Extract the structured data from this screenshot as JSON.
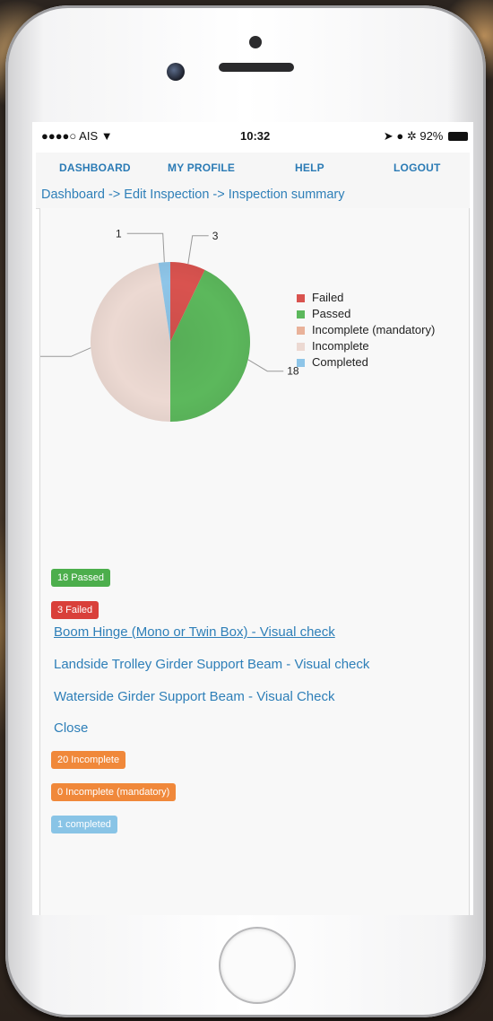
{
  "status_bar": {
    "carrier": "●●●●○ AIS",
    "time": "10:32",
    "battery": "92%"
  },
  "nav": {
    "items": [
      "DASHBOARD",
      "MY PROFILE",
      "HELP",
      "LOGOUT"
    ]
  },
  "breadcrumb": {
    "text": "Dashboard -> Edit Inspection -> Inspection summary"
  },
  "chart_data": {
    "type": "pie",
    "categories": [
      "Failed",
      "Passed",
      "Incomplete (mandatory)",
      "Incomplete",
      "Completed"
    ],
    "values": [
      3,
      18,
      0,
      20,
      1
    ],
    "colors": [
      "#d9534f",
      "#5cb85c",
      "#e9b29a",
      "#ecd9d2",
      "#8ec5e8"
    ],
    "data_labels": [
      "3",
      "18",
      "",
      "",
      "1"
    ],
    "legend_position": "right"
  },
  "summary": {
    "passed_badge": "18 Passed",
    "failed_badge": "3 Failed",
    "failed_items": [
      "Boom Hinge (Mono or Twin Box) - Visual check",
      "Landside Trolley Girder Support Beam - Visual check",
      "Waterside Girder Support Beam - Visual Check"
    ],
    "close_label": "Close",
    "incomplete_badge": "20 Incomplete",
    "incomplete_mandatory_badge": "0 Incomplete (mandatory)",
    "completed_badge": "1 completed"
  },
  "colors": {
    "passed": "#4cae4c",
    "failed": "#d9403a",
    "incomplete": "#f0883a",
    "completed": "#89c4e6",
    "link": "#2e7fb8"
  }
}
